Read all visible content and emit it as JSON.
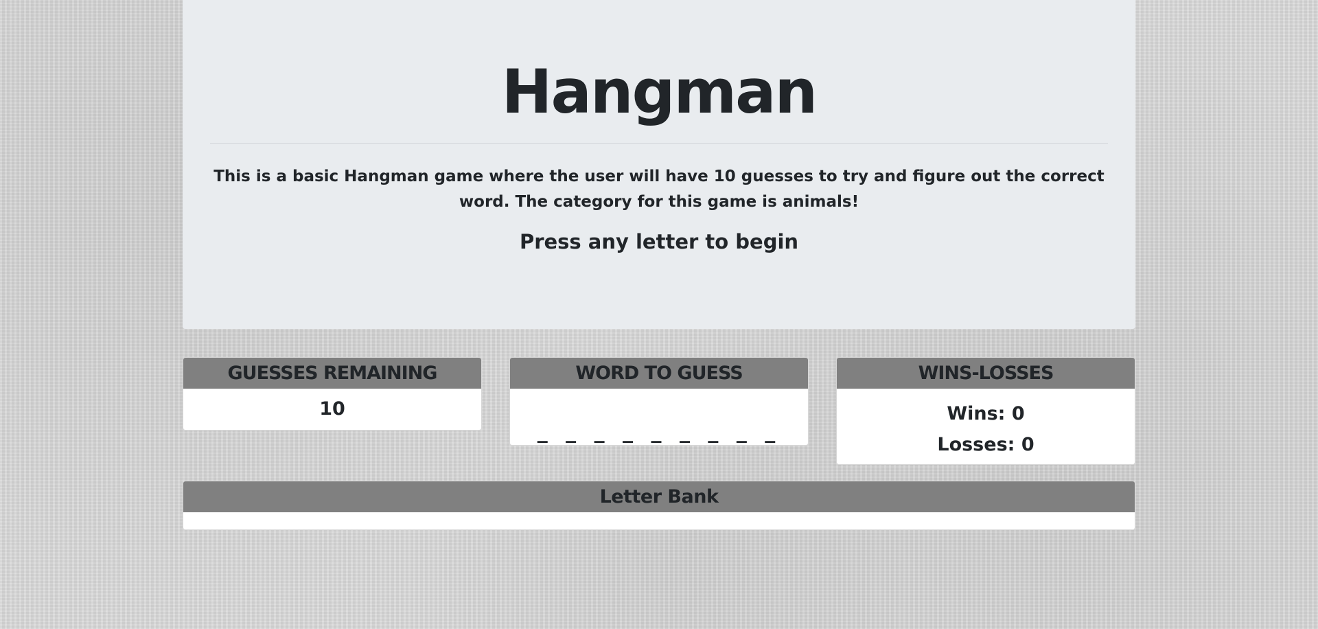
{
  "header": {
    "title": "Hangman",
    "description": "This is a basic Hangman game where the user will have 10 guesses to try and figure out the correct word. The category for this game is animals!",
    "prompt": "Press any letter to begin"
  },
  "panels": {
    "guesses": {
      "heading": "GUESSES REMAINING",
      "value": "10"
    },
    "word": {
      "heading": "WORD TO GUESS",
      "blanks": "_ _ _ _ _ _ _ _ _"
    },
    "winloss": {
      "heading": "WINS-LOSSES",
      "wins": "Wins: 0",
      "losses": "Losses: 0"
    }
  },
  "letter_bank": {
    "heading": "Letter Bank",
    "letters": ""
  },
  "colors": {
    "jumbotron_bg": "#e9ecef",
    "panel_header_bg": "#808080",
    "text": "#212529",
    "page_bg": "#d8d8d8"
  }
}
